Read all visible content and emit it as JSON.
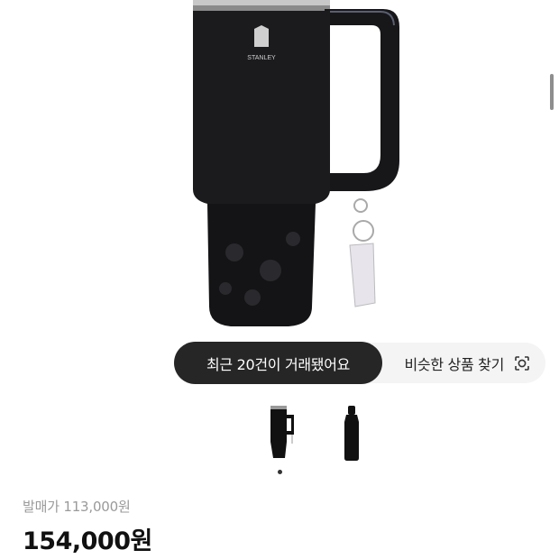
{
  "product": {
    "brand_mark": "STANLEY",
    "main_image_icon": "tumbler-with-handle-and-keychain",
    "release_price_label": "발매가 113,000원",
    "price": "154,000원"
  },
  "overlays": {
    "recent_trades": "최근 20건이 거래됐어요",
    "similar_search": "비슷한 상품 찾기",
    "similar_search_icon": "camera-search-icon"
  },
  "gallery": {
    "thumbnails": [
      "tumbler-thumbnail",
      "bottle-thumbnail"
    ],
    "active_index": 0
  },
  "colors": {
    "product_black": "#1b1b1d",
    "pill_dark": "#262626",
    "pill_light": "#f4f4f4",
    "price_text": "#111111",
    "muted_text": "#9a9a9a"
  }
}
